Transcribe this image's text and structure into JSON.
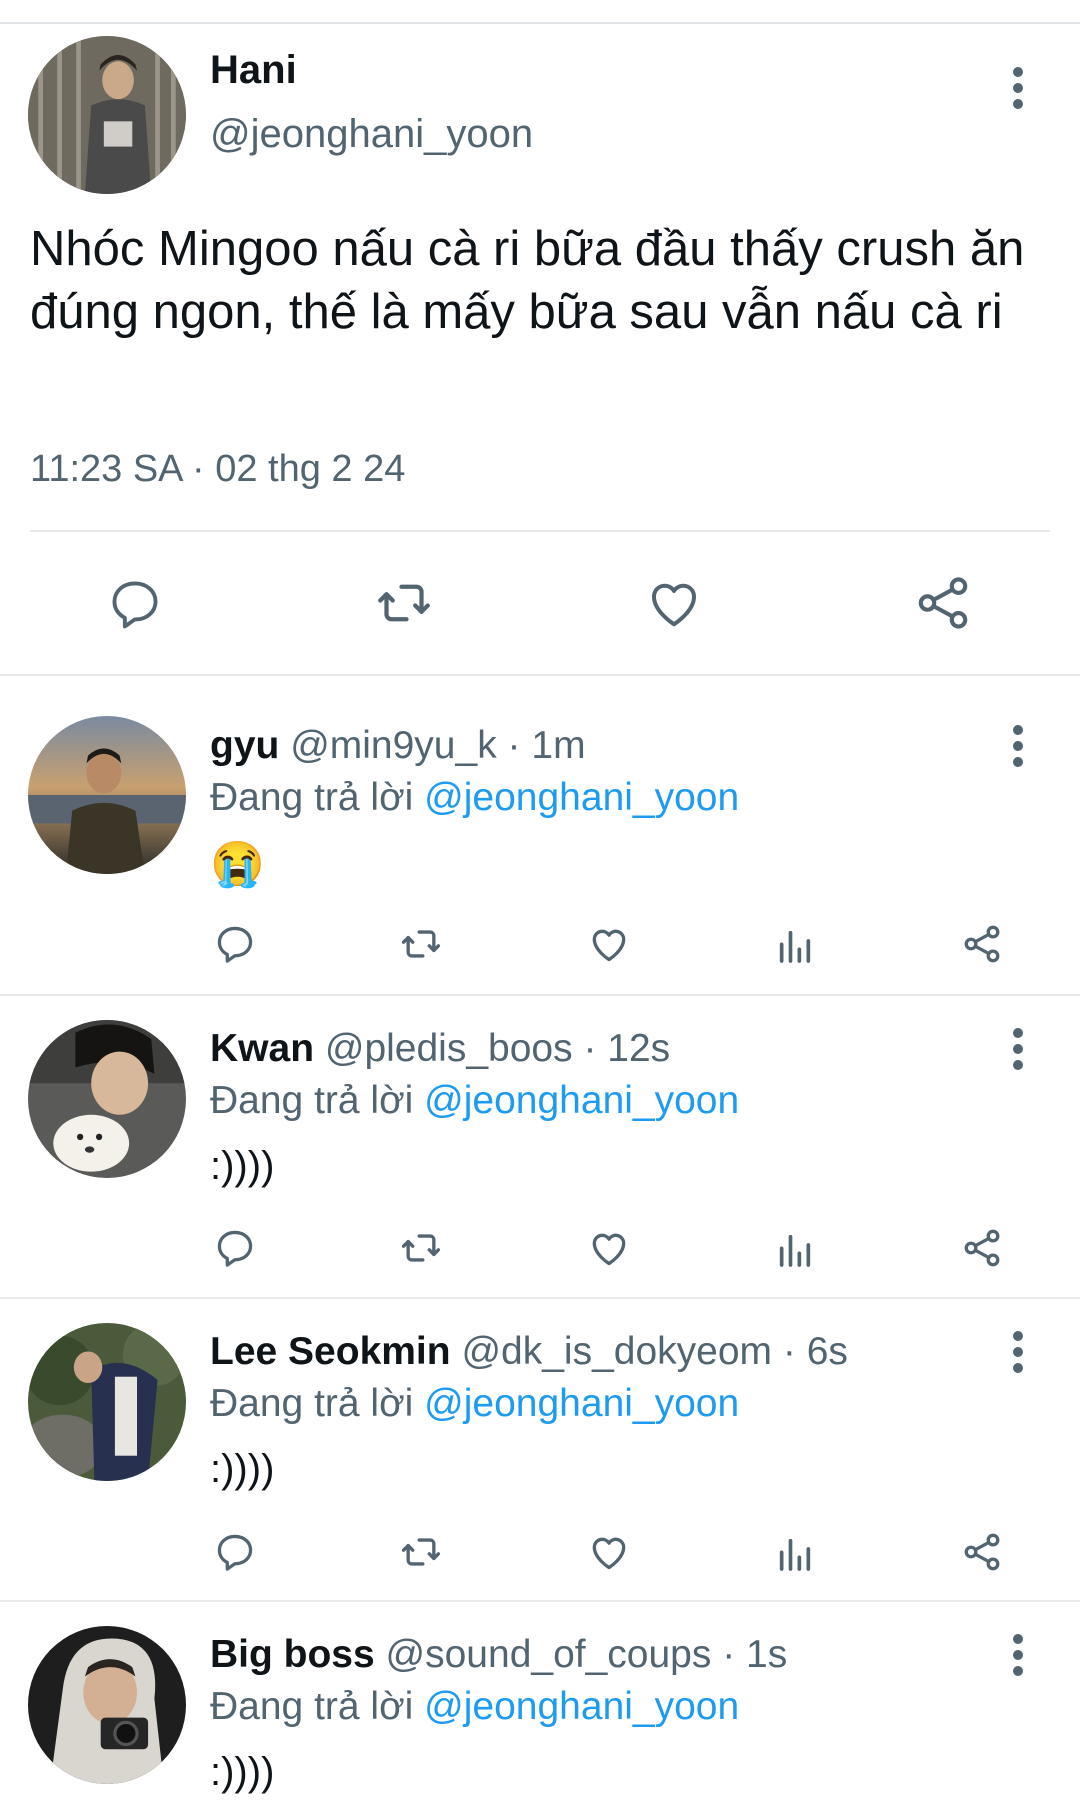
{
  "tweet": {
    "name": "Hani",
    "handle": "@jeonghani_yoon",
    "text": "Nhóc Mingoo nấu cà ri bữa đầu thấy crush ăn đúng ngon, thế là mấy bữa sau vẫn nấu cà ri",
    "time": "11:23 SA",
    "sep": "·",
    "date": "02 thg 2 24"
  },
  "reply_prefix": "Đang trả lời",
  "replies": [
    {
      "name": "gyu",
      "handle": "@min9yu_k",
      "time": "1m",
      "reply_to": "@jeonghani_yoon",
      "body": "😭",
      "body_kind": "emoji"
    },
    {
      "name": "Kwan",
      "handle": "@pledis_boos",
      "time": "12s",
      "reply_to": "@jeonghani_yoon",
      "body": ":))))",
      "body_kind": "text"
    },
    {
      "name": "Lee Seokmin",
      "handle": "@dk_is_dokyeom",
      "time": "6s",
      "reply_to": "@jeonghani_yoon",
      "body": ":))))",
      "body_kind": "text"
    },
    {
      "name": "Big boss",
      "handle": "@sound_of_coups",
      "time": "1s",
      "reply_to": "@jeonghani_yoon",
      "body": ":))))",
      "body_kind": "text"
    }
  ],
  "colors": {
    "accent": "#1d9bf0",
    "muted": "#536471",
    "icon": "#536471",
    "divider": "#e7e9ea"
  },
  "icons": {
    "action_bar": [
      "reply-icon",
      "retweet-icon",
      "like-icon",
      "share-icon"
    ],
    "reply_actions": [
      "reply-icon",
      "retweet-icon",
      "like-icon",
      "views-icon",
      "share-icon"
    ],
    "menu": "more-icon"
  }
}
